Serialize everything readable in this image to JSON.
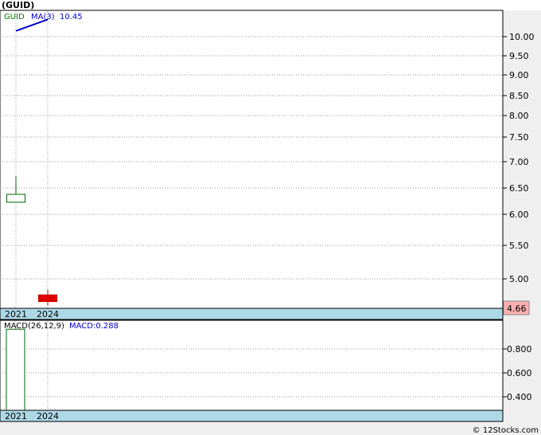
{
  "title": "(GUID)",
  "credit": "© 12Stocks.com",
  "chart_data": [
    {
      "type": "candlestick",
      "legend": {
        "symbol": "GUID",
        "ma_label": "MA(3)",
        "ma_value": "10.45"
      },
      "y_ticks": [
        "10.00",
        "9.50",
        "9.00",
        "8.50",
        "8.00",
        "7.50",
        "7.00",
        "6.50",
        "6.00",
        "5.50",
        "5.00"
      ],
      "x_ticks": [
        "2021",
        "2024"
      ],
      "last_price": "4.66",
      "candles": [
        {
          "x": "2021",
          "open": 6.23,
          "close": 6.38,
          "high": 6.72,
          "low": 6.23,
          "direction": "up"
        },
        {
          "x": "2024",
          "open": 4.76,
          "close": 4.66,
          "high": 4.84,
          "low": 4.6,
          "direction": "down"
        }
      ],
      "ma_line": [
        {
          "x": "2021",
          "value": 10.15
        },
        {
          "x": "2024",
          "value": 10.45
        }
      ]
    },
    {
      "type": "bar",
      "label": "MACD(26,12,9)",
      "macd_label": "MACD:0.288",
      "y_ticks": [
        "0.800",
        "0.600",
        "0.400"
      ],
      "x_ticks": [
        "2021",
        "2024"
      ],
      "bars": [
        {
          "x": "2021",
          "value": 0.965
        }
      ]
    }
  ]
}
